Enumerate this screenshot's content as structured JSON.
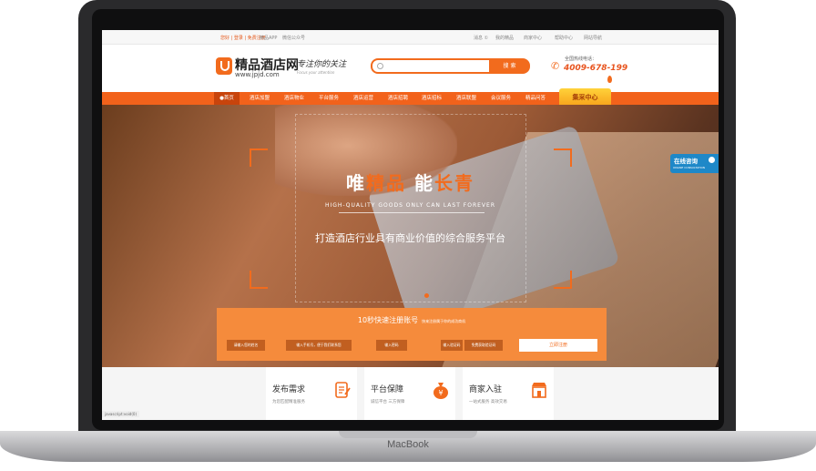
{
  "device": {
    "brand_label": "MacBook"
  },
  "topbar": {
    "welcome": "您好 | 登录 | 免费注册",
    "app": "精品APP",
    "wechat": "微信公众号",
    "messages": "消息 ①",
    "my_jingpin": "我的精品",
    "merchant_center": "商家中心",
    "help_center": "帮助中心",
    "site_nav": "网站导航"
  },
  "header": {
    "logo_text": "精品酒店网",
    "logo_url": "www.jpjd.com",
    "slogan": "专注你的关注",
    "slogan_sub": "Focus your attention",
    "search_placeholder": "",
    "search_button": "搜 索",
    "phone_label": "全国热线电话：",
    "phone_number": "4009-678-199"
  },
  "nav": {
    "items": [
      "首页",
      "酒店加盟",
      "酒店物业",
      "平台服务",
      "酒店运营",
      "酒店招聘",
      "酒店招标",
      "酒店联盟",
      "会议服务",
      "精品问答"
    ],
    "special": "集采中心"
  },
  "hero": {
    "title_part1": "唯",
    "title_hl1": "精品",
    "title_part2": " 能",
    "title_hl2": "长青",
    "subtitle": "HIGH-QUALITY GOODS ONLY CAN LAST FOREVER",
    "description": "打造酒店行业具有商业价值的综合服务平台"
  },
  "online": {
    "title": "在线咨询",
    "subtitle": "ONLINE CONSULTATION"
  },
  "register": {
    "title": "10秒快速注册账号",
    "subtitle": "快来注册属于你的成功商机",
    "fields": [
      "请输入您的姓名",
      "输入手机号，便于我们联系您",
      "输入密码",
      "输入验证码",
      "免费获取验证码"
    ],
    "button": "立即注册"
  },
  "services": [
    {
      "title": "发布需求",
      "desc": "为您匹配精准服务"
    },
    {
      "title": "平台保障",
      "desc": "诚信平台 三方保障"
    },
    {
      "title": "商家入驻",
      "desc": "一站式服务 高效交易"
    }
  ],
  "status_url": "javascript:void(0)",
  "colors": {
    "accent": "#f26b1d",
    "online": "#1e88c8"
  }
}
